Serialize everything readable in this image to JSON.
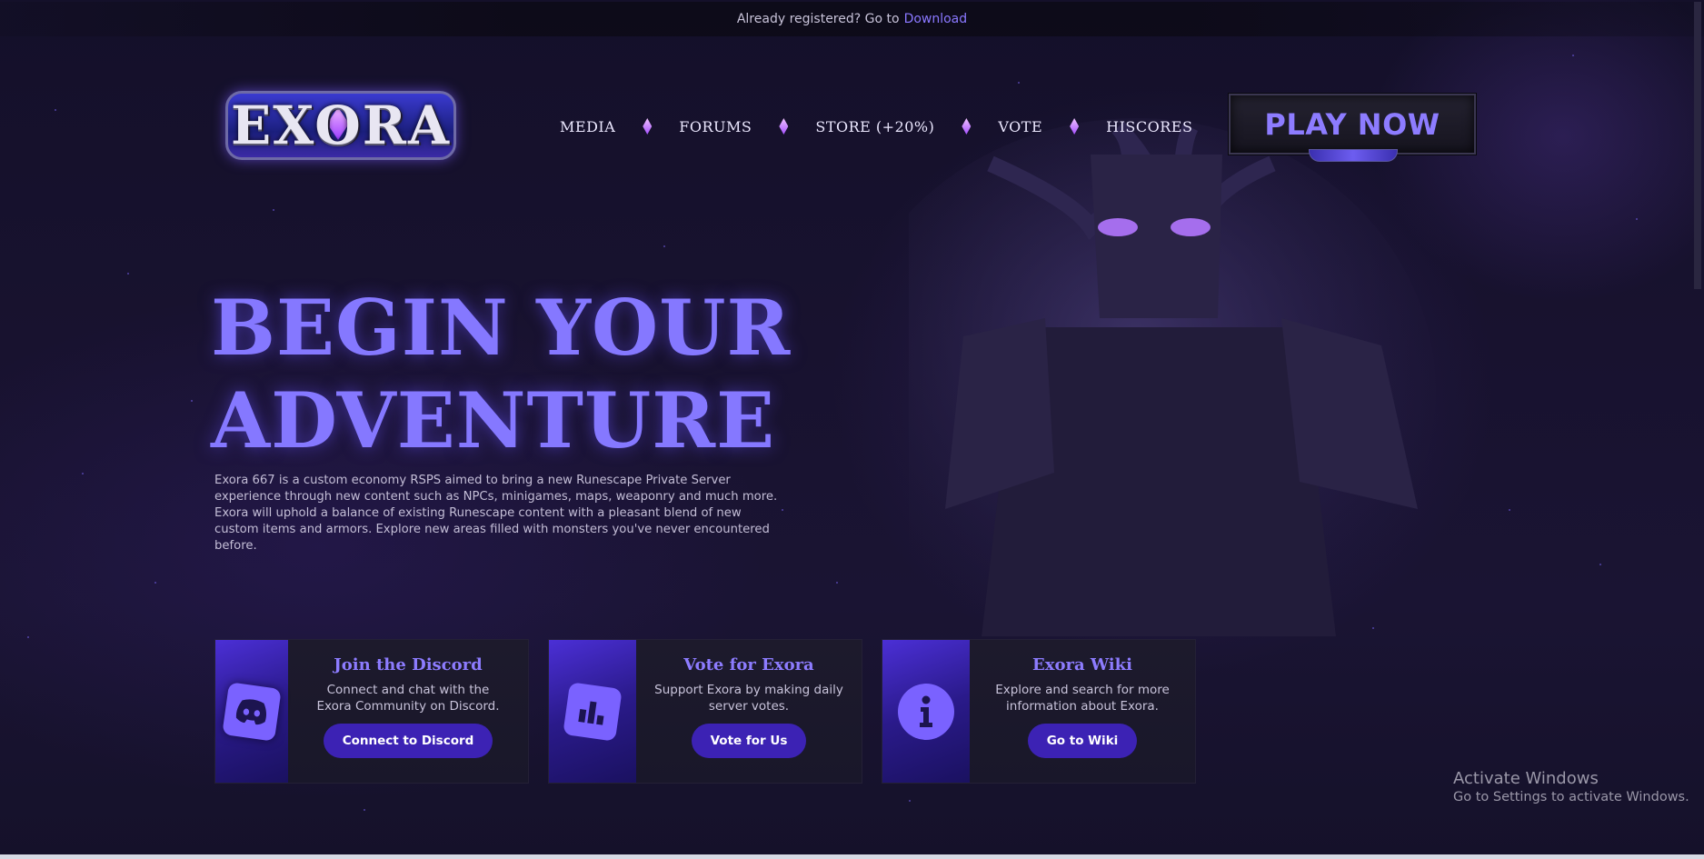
{
  "topbar": {
    "text": "Already registered? Go to",
    "link": "Download"
  },
  "logo": {
    "text": "EXORA"
  },
  "nav": {
    "items": [
      "MEDIA",
      "FORUMS",
      "STORE (+20%)",
      "VOTE",
      "HISCORES"
    ]
  },
  "play_button": "PLAY NOW",
  "hero": {
    "title_line1": "BEGIN YOUR",
    "title_line2": "ADVENTURE",
    "description": "Exora 667 is a custom economy RSPS aimed to bring a new Runescape Private Server experience through new content such as NPCs, minigames, maps, weaponry and much more. Exora will uphold a balance of existing Runescape content with a pleasant blend of new custom items and armors. Explore new areas filled with monsters you've never encountered before."
  },
  "cards": [
    {
      "title": "Join the Discord",
      "text": "Connect and chat with the Exora Community on Discord.",
      "button": "Connect to Discord",
      "icon": "discord-icon"
    },
    {
      "title": "Vote for Exora",
      "text": "Support Exora by making daily server votes.",
      "button": "Vote for Us",
      "icon": "chart-icon"
    },
    {
      "title": "Exora Wiki",
      "text": "Explore and search for more information about Exora.",
      "button": "Go to Wiki",
      "icon": "info-icon"
    }
  ],
  "windows_watermark": {
    "line1": "Activate Windows",
    "line2": "Go to Settings to activate Windows."
  },
  "colors": {
    "accent": "#8578ff",
    "button": "#3c22b4",
    "background": "#18122f"
  }
}
